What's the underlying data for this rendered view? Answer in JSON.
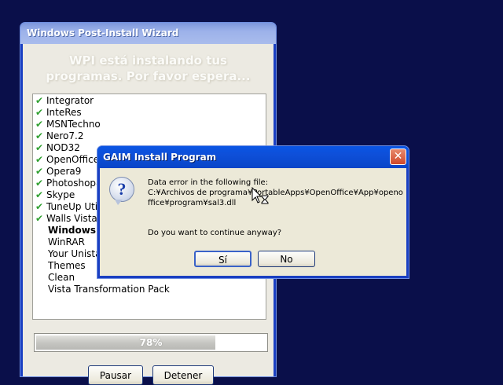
{
  "wizard": {
    "title": "Windows Post-Install Wizard",
    "heading_line1": "WPI está instalando tus",
    "heading_line2": "programas. Por favor espera...",
    "items": [
      {
        "name": "Integrator",
        "status": "done"
      },
      {
        "name": "InteRes",
        "status": "done"
      },
      {
        "name": "MSNTechno",
        "status": "done"
      },
      {
        "name": "Nero7.2",
        "status": "done"
      },
      {
        "name": "NOD32",
        "status": "done"
      },
      {
        "name": "OpenOffice",
        "status": "done"
      },
      {
        "name": "Opera9",
        "status": "done"
      },
      {
        "name": "Photoshop8",
        "status": "done"
      },
      {
        "name": "Skype",
        "status": "done"
      },
      {
        "name": "TuneUp Util",
        "status": "done"
      },
      {
        "name": "Walls Vista",
        "status": "done"
      },
      {
        "name": "WindowsKe",
        "status": "current"
      },
      {
        "name": "WinRAR",
        "status": "pending"
      },
      {
        "name": "Your Unista",
        "status": "pending"
      },
      {
        "name": "Themes",
        "status": "pending"
      },
      {
        "name": "Clean",
        "status": "pending"
      },
      {
        "name": "Vista Transformation Pack",
        "status": "pending"
      }
    ],
    "progress_value": 0.78,
    "progress_label": "78%",
    "pause_label": "Pausar",
    "stop_label": "Detener",
    "check_icon": "check-icon"
  },
  "dialog": {
    "title": "GAIM Install Program",
    "message": "Data error in the following file:\nC:¥Archivos de programa¥PortableApps¥OpenOffice¥App¥openoffice¥program¥sal3.dll",
    "question": "Do you want to continue anyway?",
    "yes_label": "Sí",
    "no_label": "No",
    "close_glyph": "✕",
    "icon": "question-icon"
  },
  "colors": {
    "desktop": "#0a0f4a",
    "xp_blue": "#0a55e4",
    "check_green": "#2e9f2e"
  }
}
